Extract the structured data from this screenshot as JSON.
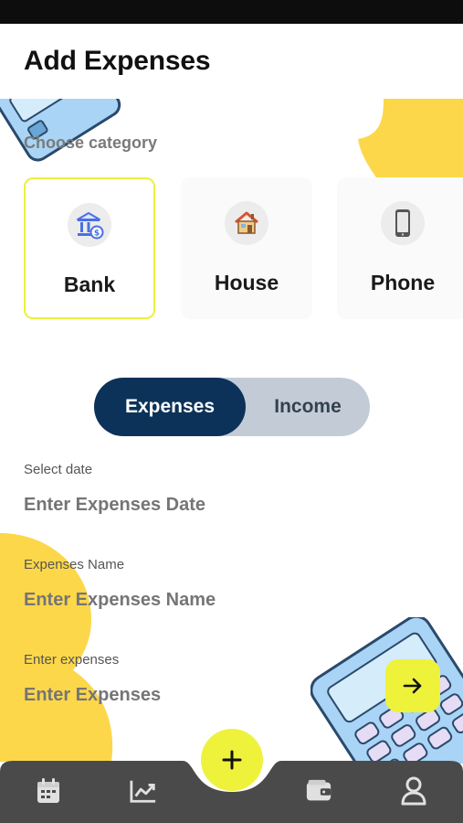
{
  "title": "Add Expenses",
  "category": {
    "label": "Choose category",
    "items": [
      {
        "label": "Bank",
        "icon": "bank-icon",
        "selected": true
      },
      {
        "label": "House",
        "icon": "house-icon",
        "selected": false
      },
      {
        "label": "Phone",
        "icon": "phone-icon",
        "selected": false
      }
    ]
  },
  "toggle": {
    "expenses": "Expenses",
    "income": "Income",
    "active": "Expenses"
  },
  "form": {
    "date": {
      "label": "Select date",
      "placeholder": "Enter Expenses Date"
    },
    "name": {
      "label": "Expenses Name",
      "placeholder": "Enter Expenses Name"
    },
    "amount": {
      "label": "Enter expenses",
      "placeholder": "Enter Expenses"
    }
  },
  "next_icon": "arrow-right-icon",
  "fab_icon": "plus-icon",
  "nav": [
    {
      "name": "calendar",
      "icon": "calendar-icon"
    },
    {
      "name": "stats",
      "icon": "chart-icon"
    },
    {
      "name": "wallet",
      "icon": "wallet-icon"
    },
    {
      "name": "profile",
      "icon": "user-icon"
    }
  ],
  "colors": {
    "accent": "#eef23b",
    "primary": "#0c3259",
    "toggle_bg": "#c3ccd6",
    "nav_bg": "#4a4a4a",
    "decor_yellow": "#fdd74a",
    "decor_blue": "#a9d4f5"
  }
}
